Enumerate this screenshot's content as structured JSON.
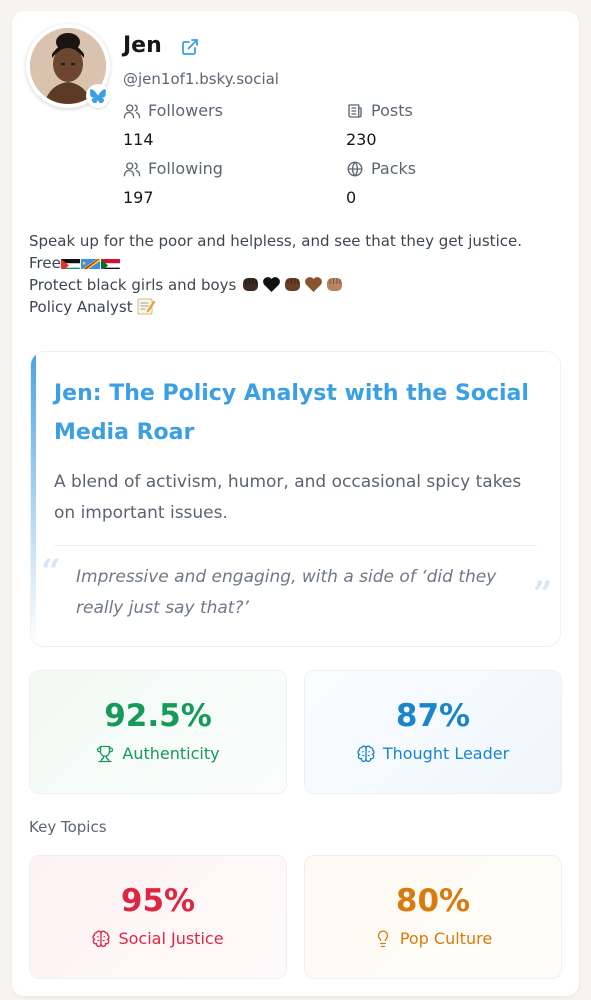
{
  "profile": {
    "name": "Jen",
    "handle": "@jen1of1.bsky.social",
    "avatar_icon": "user-avatar",
    "badge_icon": "butterfly-icon"
  },
  "stats": {
    "followers": {
      "label": "Followers",
      "value": "114",
      "icon": "users-icon"
    },
    "posts": {
      "label": "Posts",
      "value": "230",
      "icon": "newspaper-icon"
    },
    "following": {
      "label": "Following",
      "value": "197",
      "icon": "users-icon"
    },
    "packs": {
      "label": "Packs",
      "value": "0",
      "icon": "globe-icon"
    }
  },
  "bio": {
    "line1": "Speak up for the poor and helpless, and see that they get justice.",
    "line2": "Free",
    "line3": "Protect black girls and boys",
    "line4": "Policy Analyst"
  },
  "persona": {
    "title": "Jen: The Policy Analyst with the Social Media Roar",
    "description": "A blend of activism, humor, and occasional spicy takes on important issues.",
    "quote": "Impressive and engaging, with a side of ‘did they really just say that?’"
  },
  "metrics": [
    {
      "value": "92.5%",
      "label": "Authenticity",
      "icon": "trophy-icon",
      "color": "#169a5a"
    },
    {
      "value": "87%",
      "label": "Thought Leader",
      "icon": "brain-icon",
      "color": "#1a85c8"
    }
  ],
  "topics_heading": "Key Topics",
  "topics": [
    {
      "value": "95%",
      "label": "Social Justice",
      "icon": "brain-icon",
      "color": "#dc2743"
    },
    {
      "value": "80%",
      "label": "Pop Culture",
      "icon": "lightbulb-icon",
      "color": "#d97a0e"
    }
  ]
}
